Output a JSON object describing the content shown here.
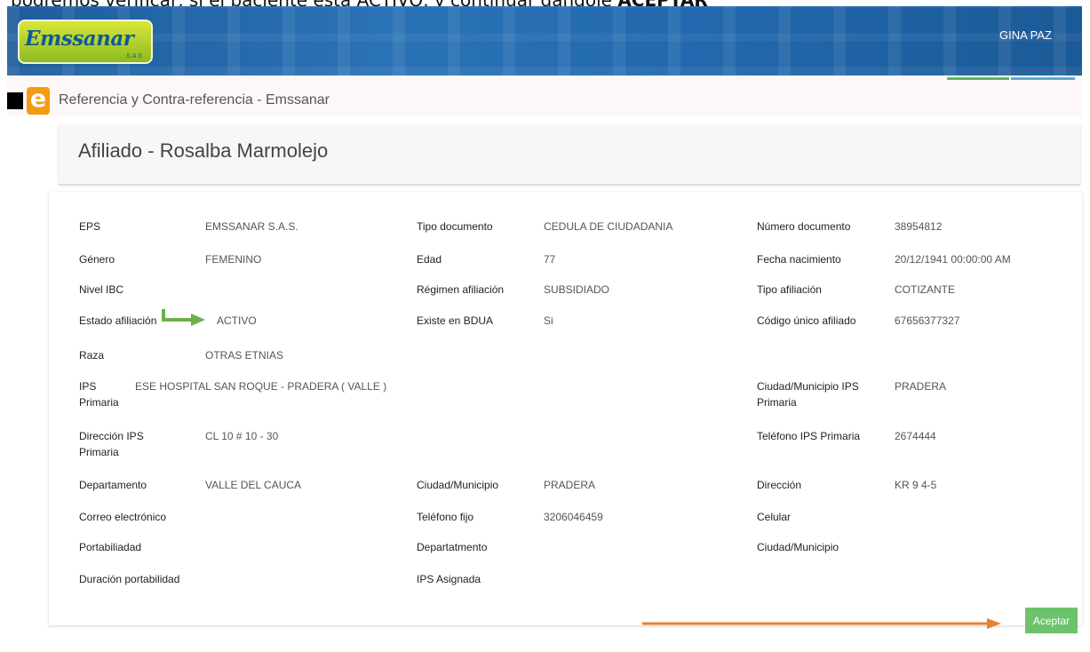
{
  "caption": {
    "text_before": "podremos verificar, si el paciente está ACTIVO, y continuar dándole ",
    "text_bold": "ACEPTAR"
  },
  "header": {
    "logo_text": "Emssanar",
    "logo_subtext": "S.A.S",
    "user_name": "GINA PAZ"
  },
  "app": {
    "icon_letter": "e",
    "title": "Referencia y Contra-referencia - Emssanar"
  },
  "card": {
    "title": "Afiliado - Rosalba Marmolejo"
  },
  "fields": {
    "eps": {
      "label": "EPS",
      "value": "EMSSANAR S.A.S."
    },
    "tipo_documento": {
      "label": "Tipo documento",
      "value": "CEDULA DE CIUDADANIA"
    },
    "numero_documento": {
      "label": "Número documento",
      "value": "38954812"
    },
    "genero": {
      "label": "Género",
      "value": "FEMENINO"
    },
    "edad": {
      "label": "Edad",
      "value": "77"
    },
    "fecha_nacimiento": {
      "label": "Fecha nacimiento",
      "value": "20/12/1941 00:00:00 AM"
    },
    "nivel_ibc": {
      "label": "Nivel IBC",
      "value": ""
    },
    "regimen_afiliacion": {
      "label": "Régimen afiliación",
      "value": "SUBSIDIADO"
    },
    "tipo_afiliacion": {
      "label": "Tipo afiliación",
      "value": "COTIZANTE"
    },
    "estado_afiliacion": {
      "label": "Estado afiliación",
      "value": "ACTIVO"
    },
    "existe_bdua": {
      "label": "Existe en BDUA",
      "value": "Si"
    },
    "codigo_unico": {
      "label": "Código único afiliado",
      "value": "67656377327"
    },
    "raza": {
      "label": "Raza",
      "value": "OTRAS ETNIAS"
    },
    "ips_primaria": {
      "label_line1": "IPS",
      "label_line2": "Primaria",
      "value": "ESE HOSPITAL SAN ROQUE - PRADERA ( VALLE )"
    },
    "ciudad_ips": {
      "label_line1": "Ciudad/Municipio IPS",
      "label_line2": "Primaria",
      "value": "PRADERA"
    },
    "direccion_ips": {
      "label_line1": "Dirección IPS",
      "label_line2": "Primaria",
      "value": "CL 10 # 10 - 30"
    },
    "telefono_ips": {
      "label": "Teléfono IPS Primaria",
      "value": "2674444"
    },
    "departamento": {
      "label": "Departamento",
      "value": "VALLE DEL CAUCA"
    },
    "ciudad_municipio": {
      "label": "Ciudad/Municipio",
      "value": "PRADERA"
    },
    "direccion": {
      "label": "Dirección",
      "value": "KR 9 4-5"
    },
    "correo": {
      "label": "Correo electrónico",
      "value": ""
    },
    "telefono_fijo": {
      "label": "Teléfono fijo",
      "value": "3206046459"
    },
    "celular": {
      "label": "Celular",
      "value": ""
    },
    "portabilidad": {
      "label": "Portabiliadad",
      "value": ""
    },
    "departamento_port": {
      "label": "Departatmento",
      "value": ""
    },
    "ciudad_municipio_port": {
      "label": "Ciudad/Municipio",
      "value": ""
    },
    "duracion_portabilidad": {
      "label": "Duración portabilidad",
      "value": ""
    },
    "ips_asignada": {
      "label": "IPS Asignada",
      "value": ""
    }
  },
  "actions": {
    "accept_label": "Aceptar"
  },
  "colors": {
    "header_blue": "#2168ad",
    "accept_green": "#6dc36d",
    "arrow_green": "#6ab04c",
    "arrow_orange": "#e8822e",
    "icon_orange": "#f39c12"
  },
  "icons": {
    "green_arrow": "green-arrow-icon",
    "orange_arrow": "orange-arrow-icon"
  }
}
